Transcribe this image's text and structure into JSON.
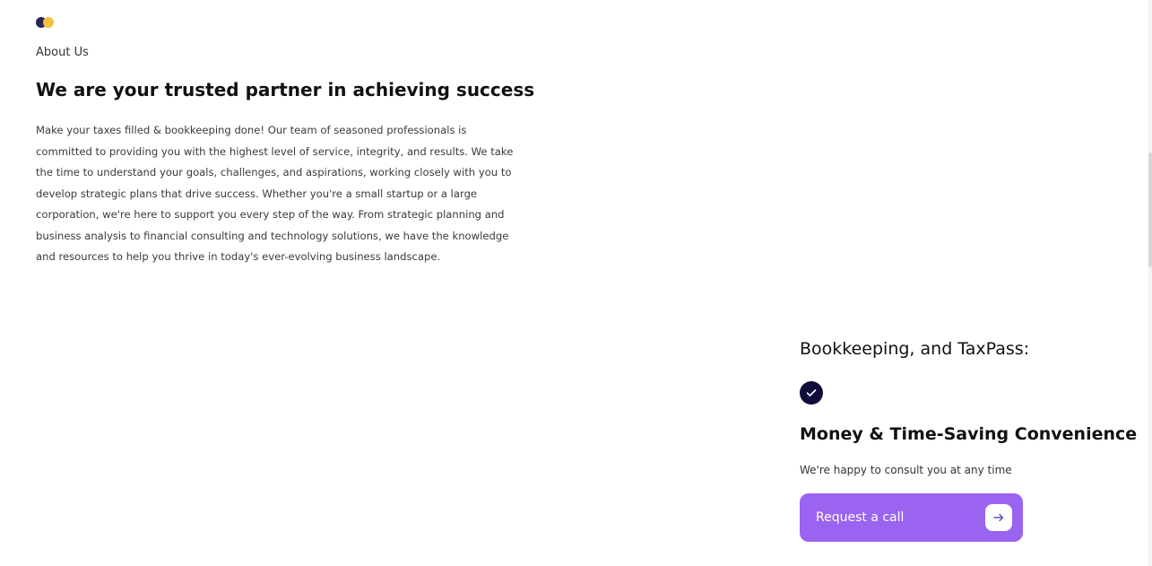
{
  "about": {
    "eyebrow": "About Us",
    "headline": "We are your trusted partner in achieving success",
    "body": "Make your taxes filled & bookkeeping done! Our team of seasoned professionals is committed to providing you with the highest level of service, integrity, and results. We take the time to understand your goals, challenges, and aspirations, working closely with you to develop strategic plans that drive success. Whether you're a small startup or a large corporation, we're here to support you every step of the way. From strategic planning and business analysis to financial consulting and technology solutions, we have the knowledge and resources to help you thrive in today's ever-evolving business landscape."
  },
  "feature": {
    "title": "Bookkeeping, and TaxPass:",
    "subtitle": "Money & Time-Saving Convenience",
    "consult_text": "We're happy to consult you at any time",
    "cta_label": "Request a call"
  },
  "icons": {
    "logo": "brand-logo-dots",
    "check": "check-circle-icon",
    "arrow": "arrow-right-icon"
  },
  "colors": {
    "accent_purple": "#9a63f0",
    "navy": "#0f0c3a",
    "logo_navy": "#2b2456",
    "logo_yellow": "#f6c23e"
  }
}
